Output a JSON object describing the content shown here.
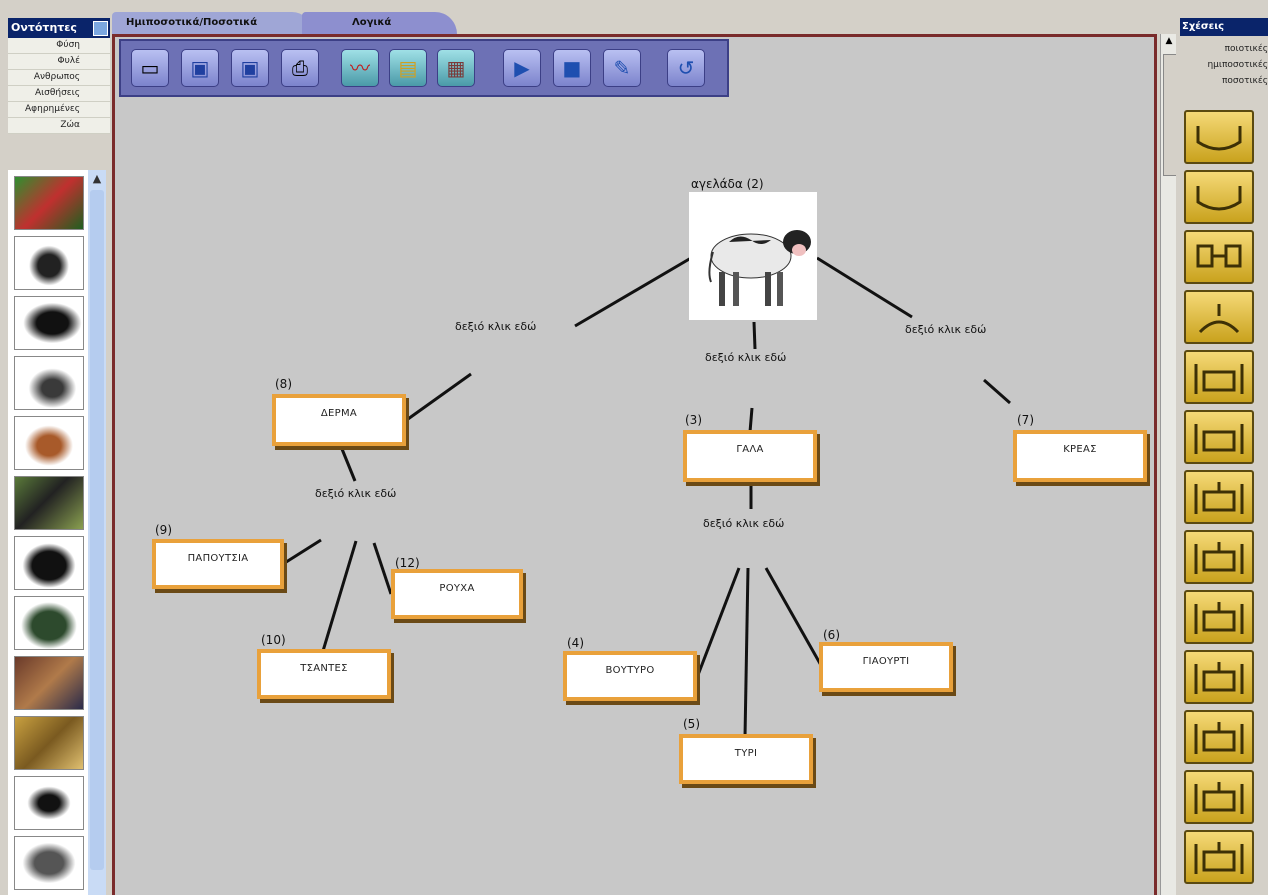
{
  "left_panel": {
    "title": "Οντότητες",
    "categories": [
      "Φύση",
      "Φυλέ",
      "Ανθρωπος",
      "Αισθήσεις",
      "Αφηρημένες",
      "Ζώα"
    ],
    "thumbnails": [
      "animal-thumb-1",
      "animal-thumb-2",
      "animal-thumb-3",
      "animal-thumb-4",
      "animal-thumb-5",
      "animal-thumb-6",
      "animal-thumb-7",
      "animal-thumb-8",
      "animal-thumb-9",
      "animal-thumb-10",
      "animal-thumb-11",
      "animal-thumb-12"
    ]
  },
  "tabs": [
    "Ημιποσοτικά/Ποσοτικά",
    "Λογικά"
  ],
  "toolbar": {
    "buttons": [
      "new-icon",
      "save-icon",
      "save-as-icon",
      "print-icon",
      "graph-icon",
      "bars-icon",
      "table-icon",
      "play-icon",
      "stop-icon",
      "edit-icon",
      "undo-icon"
    ]
  },
  "concept_map": {
    "root": {
      "label": "αγελάδα (2)"
    },
    "links": [
      "δεξιό κλικ εδώ",
      "δεξιό κλικ εδώ",
      "δεξιό κλικ εδώ",
      "δεξιό κλικ εδώ",
      "δεξιό κλικ εδώ"
    ],
    "nodes": [
      {
        "num": "(8)",
        "label": "ΔΕΡΜΑ"
      },
      {
        "num": "(3)",
        "label": "ΓΑΛΑ"
      },
      {
        "num": "(7)",
        "label": "ΚΡΕΑΣ"
      },
      {
        "num": "(9)",
        "label": "ΠΑΠΟΥΤΣΙΑ"
      },
      {
        "num": "(12)",
        "label": "ΡΟΥΧΑ"
      },
      {
        "num": "(10)",
        "label": "ΤΣΑΝΤΕΣ"
      },
      {
        "num": "(4)",
        "label": "ΒΟΥΤΥΡΟ"
      },
      {
        "num": "(6)",
        "label": "ΓΙΑΟΥΡΤΙ"
      },
      {
        "num": "(5)",
        "label": "ΤΥΡΙ"
      }
    ]
  },
  "right_panel": {
    "title": "Σχέσεις",
    "items": [
      "ποιοτικές",
      "ημιποσοτικές",
      "ποσοτικές"
    ],
    "shapes": [
      "relation-shape-1",
      "relation-shape-2",
      "relation-shape-3",
      "relation-shape-4",
      "relation-shape-5",
      "relation-shape-6",
      "relation-shape-7",
      "relation-shape-8",
      "relation-shape-9",
      "relation-shape-10",
      "relation-shape-11",
      "relation-shape-12",
      "relation-shape-13"
    ]
  }
}
